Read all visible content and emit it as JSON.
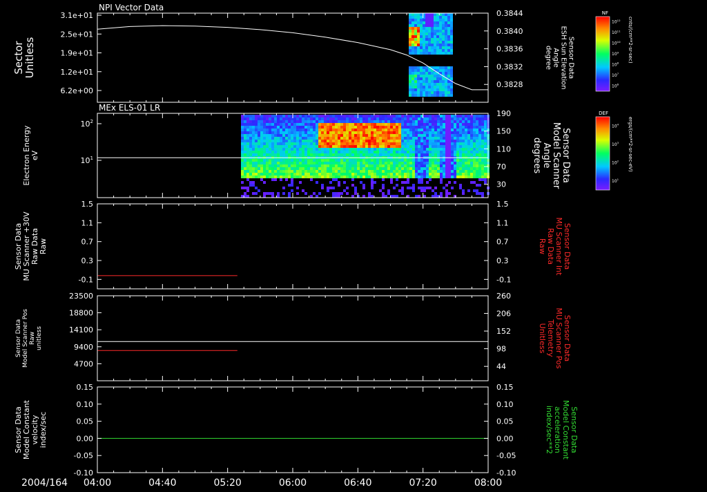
{
  "colors": {
    "background": "#000000",
    "axis": "#ffffff",
    "red_trace": "#ff2a2a",
    "green_trace": "#33dd33"
  },
  "footer": {
    "date": "2004/164"
  },
  "time_axis": {
    "start": "04:00",
    "end": "08:00",
    "tick_labels": [
      "04:00",
      "04:40",
      "05:20",
      "06:00",
      "06:40",
      "07:20",
      "08:00"
    ],
    "tick_minutes": [
      240,
      280,
      320,
      360,
      400,
      440,
      480
    ]
  },
  "colorbars": [
    {
      "label": "NF",
      "unit": "cnts/(cm**2-sr-sec)",
      "ticks": [
        "10^12",
        "10^11",
        "10^10",
        "10^9",
        "10^8",
        "10^7",
        "10^6"
      ]
    },
    {
      "label": "DEF",
      "unit": "ergs/(cm**2-sr-sec-eV)",
      "ticks": [
        "10^4",
        "10^3",
        "10^2",
        "10^1"
      ]
    }
  ],
  "chart_data": [
    {
      "type": "heatmap",
      "title": "NPI Vector Data",
      "ylabel_left": [
        "Sector",
        "Unitless"
      ],
      "yticks_left": [
        "3.1e+01",
        "2.5e+01",
        "1.9e+01",
        "1.2e+01",
        "6.2e+00"
      ],
      "ylabel_right": [
        "Sensor Data",
        "ESH Sun Elevation",
        "Angle",
        "degree"
      ],
      "yticks_right": [
        "0.3844",
        "0.3840",
        "0.3836",
        "0.3832",
        "0.3828"
      ],
      "ylim_right": [
        0.3824,
        0.3844
      ],
      "line_series": {
        "color": "#ffffff",
        "x_minutes": [
          240,
          260,
          280,
          300,
          320,
          340,
          360,
          380,
          400,
          420,
          430,
          440,
          450,
          460,
          470,
          480
        ],
        "y": [
          0.38404,
          0.3841,
          0.38412,
          0.38411,
          0.38408,
          0.38403,
          0.38396,
          0.38386,
          0.38374,
          0.38358,
          0.38346,
          0.38328,
          0.38304,
          0.38282,
          0.38268,
          0.38268
        ]
      }
    },
    {
      "type": "heatmap",
      "title": "MEx ELS-01 LR",
      "ylabel_left": [
        "Electron Energy",
        "eV"
      ],
      "yticks_left": [
        "10^2",
        "10^1"
      ],
      "ylabel_right": [
        "Sensor Data",
        "Model Scanner",
        "Angle",
        "degrees"
      ],
      "yticks_right": [
        "190",
        "150",
        "110",
        "70",
        "30"
      ],
      "ylim_right": [
        0,
        190
      ],
      "line_series": {
        "color": "#ffffff",
        "x_minutes": [
          240,
          480
        ],
        "y": [
          90,
          90
        ]
      }
    },
    {
      "type": "line",
      "ylabel_left": [
        "Sensor Data",
        "MU Scanner +30V",
        "Raw Data",
        "Raw"
      ],
      "yticks_left": [
        "1.5",
        "1.1",
        "0.7",
        "0.3",
        "-0.1"
      ],
      "ylim_left": [
        -0.3,
        1.5
      ],
      "ylabel_right": [
        "Sensor Data",
        "MU Scanner Int",
        "Raw Data",
        "Raw"
      ],
      "yticks_right": [
        "1.5",
        "1.1",
        "0.7",
        "0.3",
        "-0.1"
      ],
      "ylim_right": [
        -0.3,
        1.5
      ],
      "series": [
        {
          "color": "#ff2a2a",
          "x_minutes": [
            240,
            326
          ],
          "y": [
            -0.02,
            -0.02
          ]
        }
      ]
    },
    {
      "type": "line",
      "ylabel_left": [
        "Sensor Data",
        "Model Scanner Pos",
        "Raw",
        "unitless"
      ],
      "yticks_left": [
        "23500",
        "18800",
        "14100",
        "9400",
        "4700"
      ],
      "ylim_left": [
        0,
        23500
      ],
      "ylabel_right": [
        "Sensor Data",
        "MU Scanner Pos",
        "Telemetry",
        "Unitless"
      ],
      "yticks_right": [
        "260",
        "206",
        "152",
        "98",
        "44"
      ],
      "ylim_right": [
        0,
        260
      ],
      "series": [
        {
          "color": "#ff2a2a",
          "axis": "left",
          "x_minutes": [
            240,
            326
          ],
          "y": [
            8350,
            8350
          ]
        },
        {
          "color": "#ffffff",
          "axis": "right",
          "x_minutes": [
            240,
            480
          ],
          "y": [
            120,
            120
          ]
        }
      ]
    },
    {
      "type": "line",
      "ylabel_left": [
        "Sensor Data",
        "Model Constant",
        "velocity",
        "index/sec"
      ],
      "yticks_left": [
        "0.15",
        "0.10",
        "0.05",
        "0.00",
        "-0.05",
        "-0.10"
      ],
      "ylim_left": [
        -0.1,
        0.15
      ],
      "ylabel_right": [
        "Sensor Data",
        "Model Constant",
        "acceleration",
        "index/sec**2"
      ],
      "yticks_right": [
        "0.15",
        "0.10",
        "0.05",
        "0.00",
        "-0.05",
        "-0.10"
      ],
      "ylim_right": [
        -0.1,
        0.15
      ],
      "series": [
        {
          "color": "#33dd33",
          "x_minutes": [
            240,
            480
          ],
          "y": [
            0.0,
            0.0
          ]
        }
      ]
    }
  ]
}
